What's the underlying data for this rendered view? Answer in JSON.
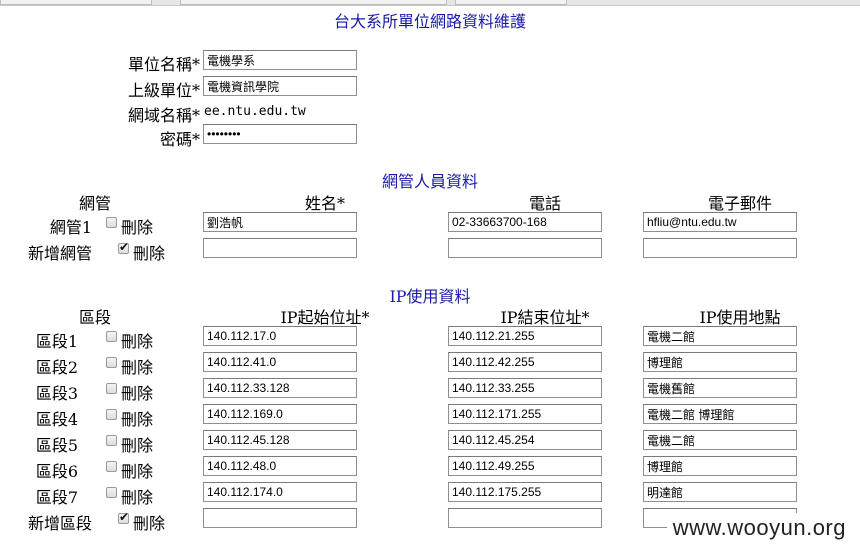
{
  "page": {
    "title": "台大系所單位網路資料維護"
  },
  "unit": {
    "name_label": "單位名稱*",
    "name_value": "電機學系",
    "parent_label": "上級單位*",
    "parent_value": "電機資訊學院",
    "domain_label": "網域名稱*",
    "domain_value": "ee.ntu.edu.tw",
    "password_label": "密碼*",
    "password_value": "••••••••"
  },
  "admins": {
    "section_title": "網管人員資料",
    "headers": {
      "admin": "網管",
      "name": "姓名*",
      "phone": "電話",
      "email": "電子郵件"
    },
    "rows": [
      {
        "label": "網管1",
        "delete_label": "刪除",
        "checked": false,
        "name": "劉浩帆",
        "phone": "02-33663700-168",
        "email": "hfliu@ntu.edu.tw"
      }
    ],
    "new_row": {
      "label": "新增網管",
      "delete_label": "刪除",
      "checked": true
    }
  },
  "ip": {
    "section_title": "IP使用資料",
    "headers": {
      "segment": "區段",
      "start": "IP起始位址*",
      "end": "IP結束位址*",
      "location": "IP使用地點"
    },
    "rows": [
      {
        "label": "區段1",
        "delete_label": "刪除",
        "checked": false,
        "start": "140.112.17.0",
        "end": "140.112.21.255",
        "location": "電機二館"
      },
      {
        "label": "區段2",
        "delete_label": "刪除",
        "checked": false,
        "start": "140.112.41.0",
        "end": "140.112.42.255",
        "location": "博理館"
      },
      {
        "label": "區段3",
        "delete_label": "刪除",
        "checked": false,
        "start": "140.112.33.128",
        "end": "140.112.33.255",
        "location": "電機舊館"
      },
      {
        "label": "區段4",
        "delete_label": "刪除",
        "checked": false,
        "start": "140.112.169.0",
        "end": "140.112.171.255",
        "location": "電機二館 博理館"
      },
      {
        "label": "區段5",
        "delete_label": "刪除",
        "checked": false,
        "start": "140.112.45.128",
        "end": "140.112.45.254",
        "location": "電機二館"
      },
      {
        "label": "區段6",
        "delete_label": "刪除",
        "checked": false,
        "start": "140.112.48.0",
        "end": "140.112.49.255",
        "location": "博理館"
      },
      {
        "label": "區段7",
        "delete_label": "刪除",
        "checked": false,
        "start": "140.112.174.0",
        "end": "140.112.175.255",
        "location": "明達館"
      }
    ],
    "new_row": {
      "label": "新增區段",
      "delete_label": "刪除",
      "checked": true
    }
  },
  "watermark": "www.wooyun.org"
}
